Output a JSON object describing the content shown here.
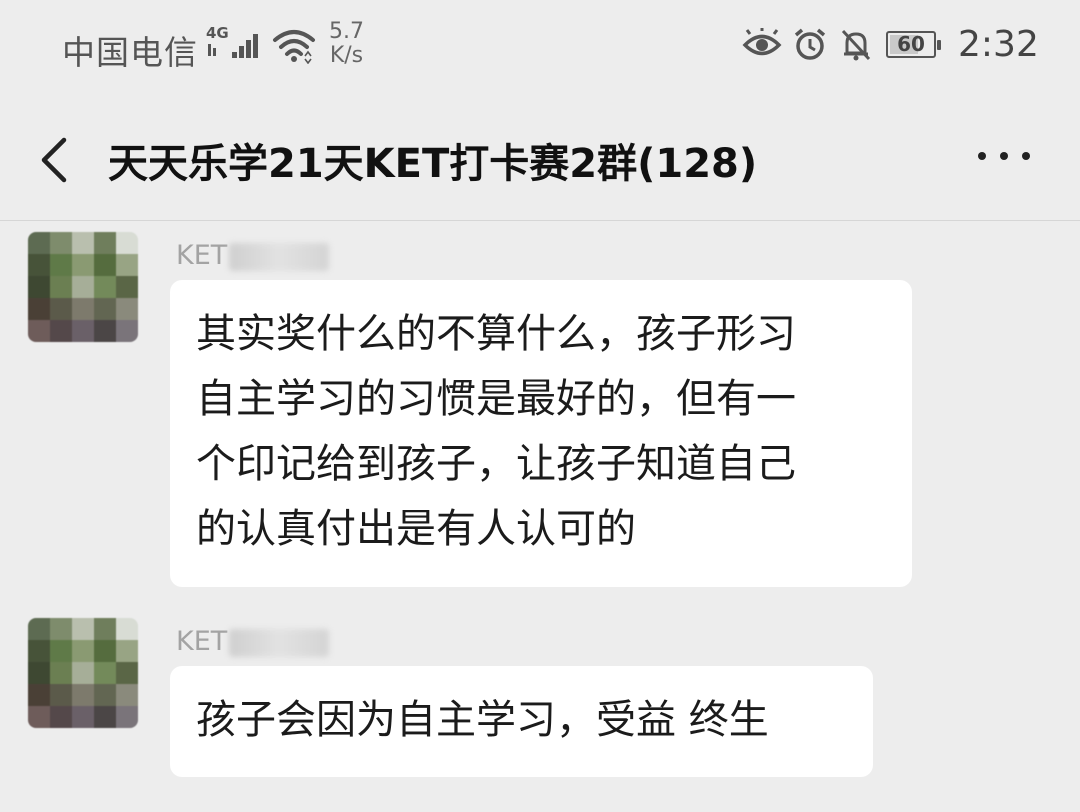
{
  "status_bar": {
    "carrier": "中国电信",
    "network": "4G",
    "speed_value": "5.7",
    "speed_unit": "K/s",
    "battery": "60",
    "time": "2:32",
    "icons": [
      "eye-icon",
      "alarm-icon",
      "bell-off-icon",
      "battery-icon"
    ]
  },
  "header": {
    "title": "天天乐学21天KET打卡赛2群(128)",
    "back_icon": "chevron-left-icon",
    "more_icon": "more-dots-icon"
  },
  "messages": [
    {
      "sender": "KET",
      "lines": [
        "其实奖什么的不算什么，孩子形习",
        "自主学习的习惯是最好的，但有一",
        "个印记给到孩子，让孩子知道自己",
        "的认真付出是有人认可的"
      ]
    },
    {
      "sender": "KET",
      "lines": [
        "孩子会因为自主学习，受益 终生"
      ]
    }
  ],
  "colors": {
    "background": "#ededed",
    "bubble": "#ffffff",
    "sender_text": "#a3a3a3"
  }
}
